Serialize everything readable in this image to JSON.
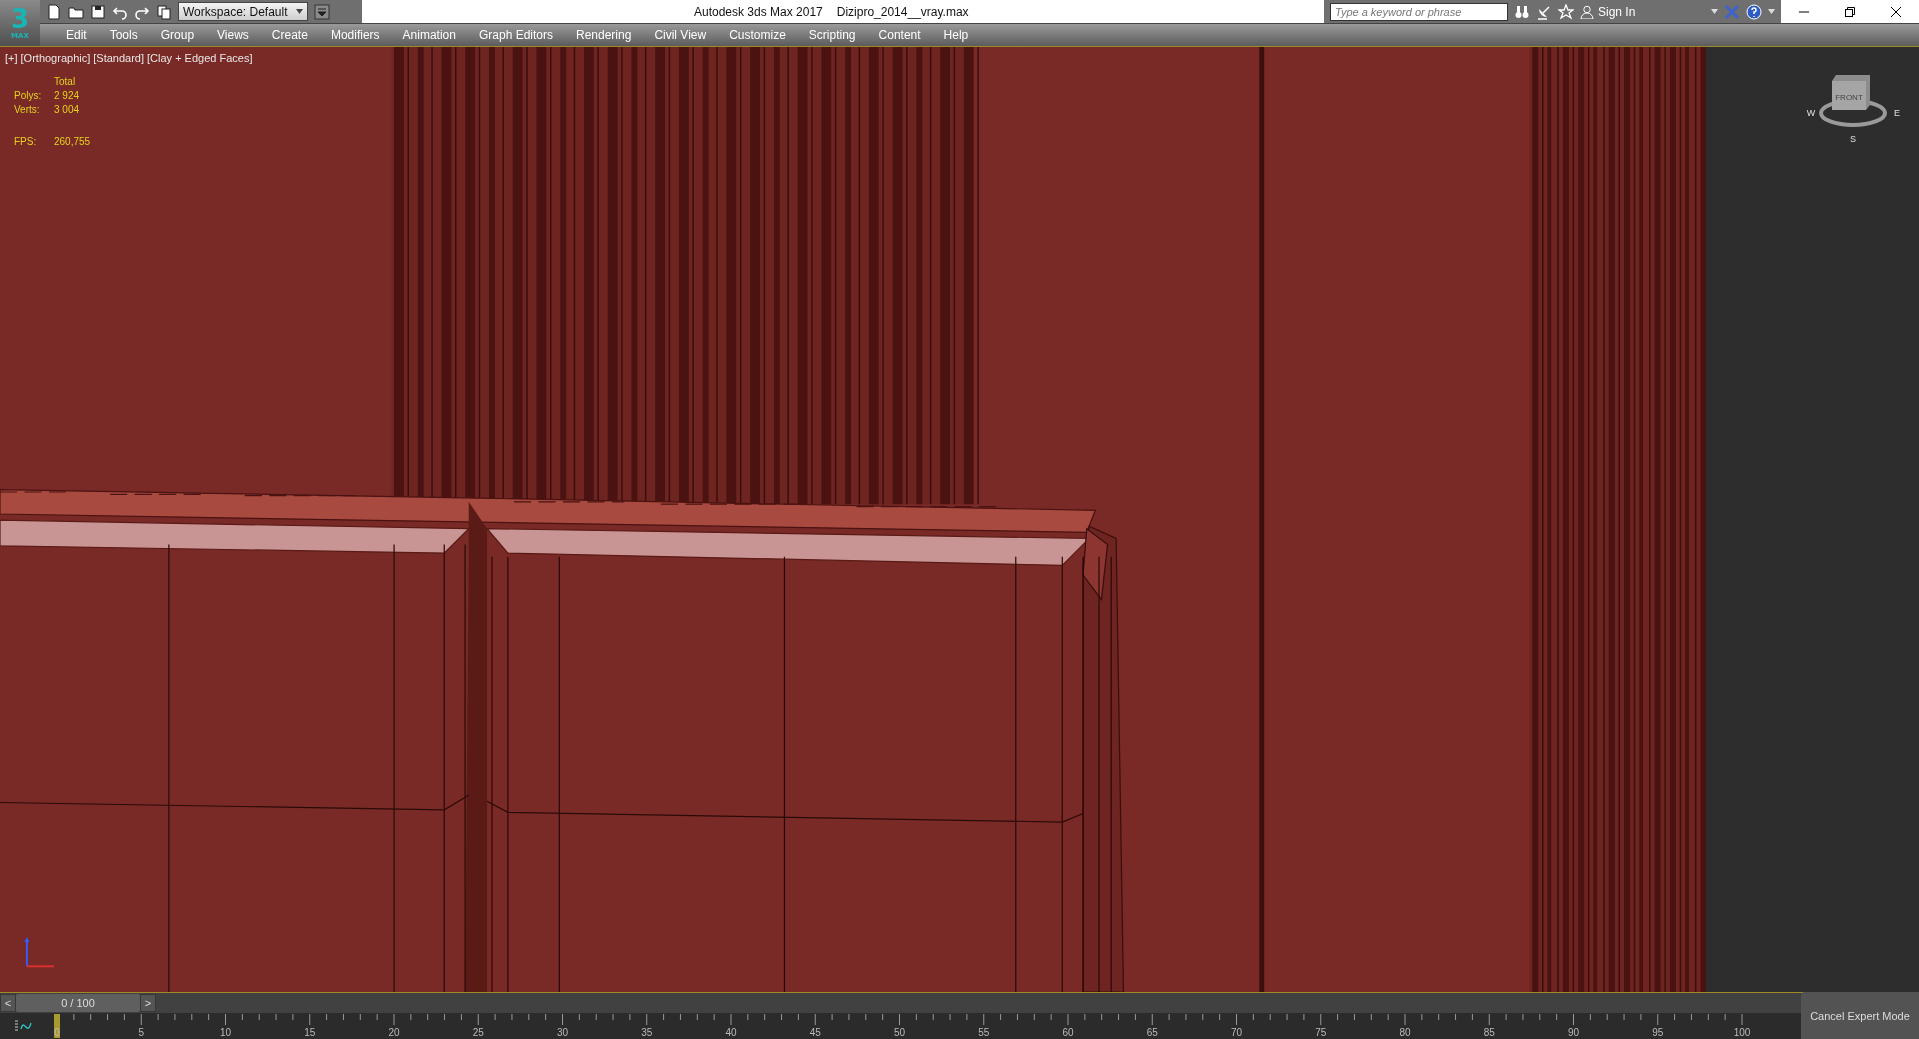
{
  "logo": {
    "glyph": "3",
    "sub": "MAX"
  },
  "workspace": {
    "label": "Workspace: Default"
  },
  "title": {
    "app": "Autodesk 3ds Max 2017",
    "file": "Dizipro_2014__vray.max"
  },
  "search": {
    "placeholder": "Type a keyword or phrase"
  },
  "account": {
    "label": "Sign In"
  },
  "menu": [
    {
      "label": "Edit"
    },
    {
      "label": "Tools"
    },
    {
      "label": "Group"
    },
    {
      "label": "Views"
    },
    {
      "label": "Create"
    },
    {
      "label": "Modifiers"
    },
    {
      "label": "Animation"
    },
    {
      "label": "Graph Editors"
    },
    {
      "label": "Rendering"
    },
    {
      "label": "Civil View"
    },
    {
      "label": "Customize"
    },
    {
      "label": "Scripting"
    },
    {
      "label": "Content"
    },
    {
      "label": "Help"
    }
  ],
  "viewport": {
    "labels": [
      "[+]",
      "[Orthographic]",
      "[Standard]",
      "[Clay + Edged Faces]"
    ],
    "stats": {
      "heading": "Total",
      "rows": [
        {
          "label": "Polys:",
          "value": "2 924"
        },
        {
          "label": "Verts:",
          "value": "3 004"
        }
      ],
      "fps": {
        "label": "FPS:",
        "value": "260,755"
      }
    },
    "view_cube": {
      "face": "FRONT",
      "compass": [
        "W",
        "E",
        "S"
      ]
    }
  },
  "time_slider": {
    "prev": "<",
    "next": ">",
    "reading": "0 / 100",
    "level": 0
  },
  "track_bar": {
    "ticks": [
      "0",
      "5",
      "10",
      "15",
      "20",
      "25",
      "30",
      "35",
      "40",
      "45",
      "50",
      "55",
      "60",
      "65",
      "70",
      "75",
      "80",
      "85",
      "90",
      "95",
      "100"
    ]
  },
  "expert_mode": {
    "label": "Cancel Expert Mode"
  }
}
